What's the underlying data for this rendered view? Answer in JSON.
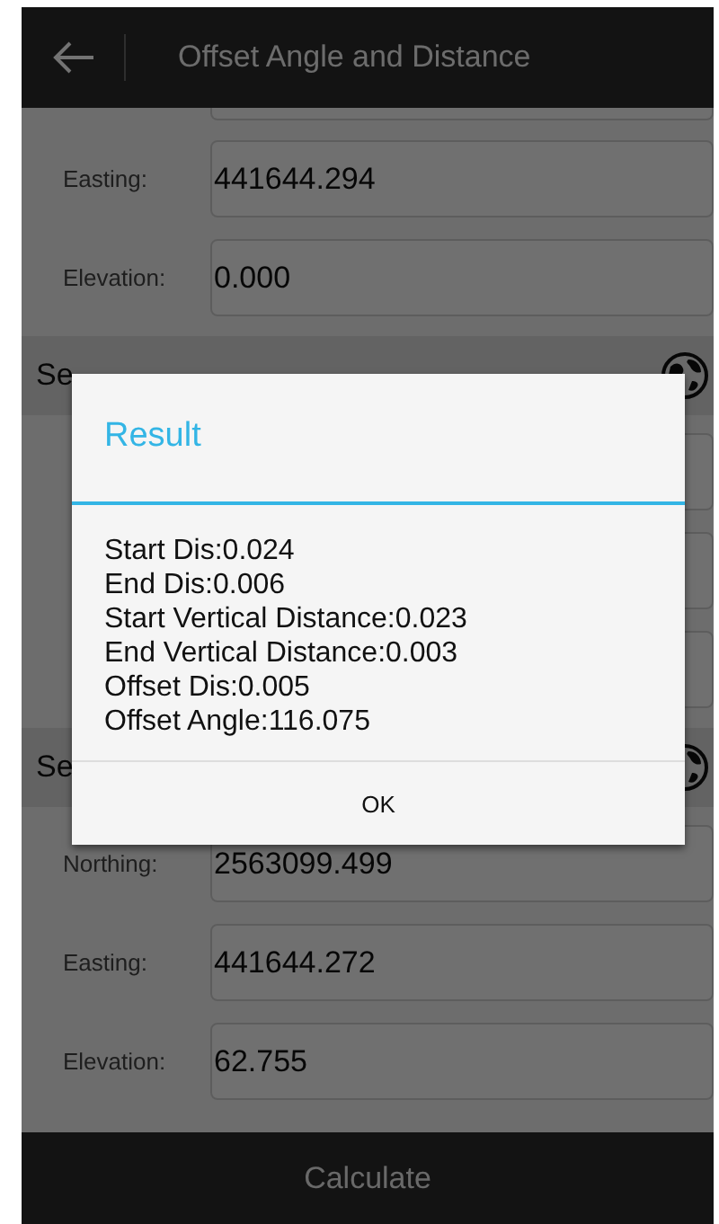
{
  "header": {
    "title": "Offset Angle and Distance"
  },
  "form": [
    {
      "kind": "field",
      "label": "Easting:",
      "value": "441644.294"
    },
    {
      "kind": "field",
      "label": "Elevation:",
      "value": "0.000"
    },
    {
      "kind": "section",
      "title": "Se"
    },
    {
      "kind": "field"
    },
    {
      "kind": "field"
    },
    {
      "kind": "field"
    },
    {
      "kind": "section",
      "title": "Se"
    },
    {
      "kind": "field",
      "label": "Northing:",
      "value": "2563099.499"
    },
    {
      "kind": "field",
      "label": "Easting:",
      "value": "441644.272"
    },
    {
      "kind": "field",
      "label": "Elevation:",
      "value": "62.755"
    }
  ],
  "footer_button": "Calculate",
  "dialog": {
    "title": "Result",
    "lines": [
      "Start Dis:0.024",
      "End Dis:0.006",
      "Start Vertical Distance:0.023",
      "End Vertical Distance:0.003",
      "Offset Dis:0.005",
      "Offset Angle:116.075"
    ],
    "button": "OK"
  }
}
